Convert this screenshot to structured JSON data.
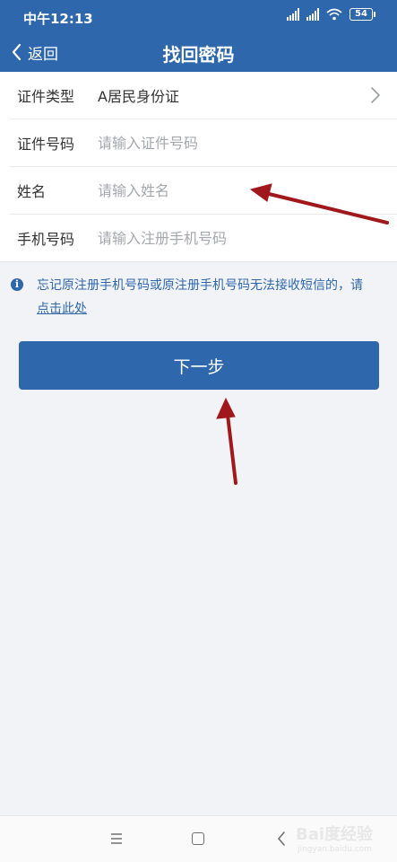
{
  "status_bar": {
    "time": "中午12:13",
    "battery": "54"
  },
  "nav": {
    "back_label": "返回",
    "title": "找回密码"
  },
  "form": {
    "rows": [
      {
        "label": "证件类型",
        "value": "A居民身份证"
      },
      {
        "label": "证件号码",
        "placeholder": "请输入证件号码"
      },
      {
        "label": "姓名",
        "placeholder": "请输入姓名"
      },
      {
        "label": "手机号码",
        "placeholder": "请输入注册手机号码"
      }
    ]
  },
  "notice": {
    "text": "忘记原注册手机号码或原注册手机号码无法接收短信的，请",
    "link": "点击此处"
  },
  "actions": {
    "next_label": "下一步"
  },
  "watermark": {
    "main": "Bai度经验",
    "sub": "jingyan.baidu.com"
  },
  "colors": {
    "brand": "#2e67ab",
    "annotation_arrow": "#a0181c"
  }
}
